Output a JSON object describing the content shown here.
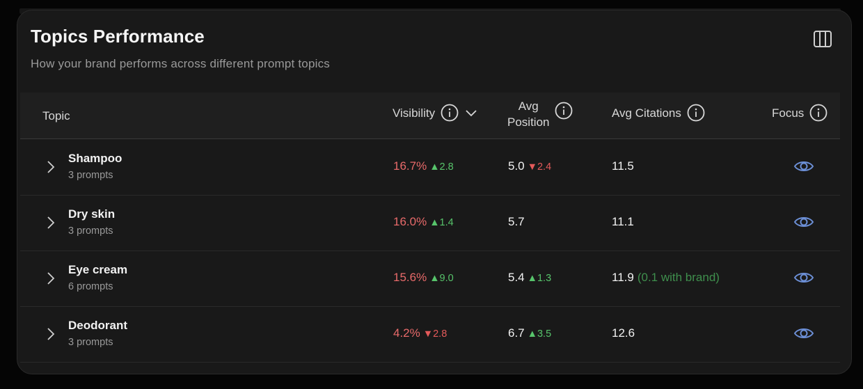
{
  "header": {
    "title": "Topics Performance",
    "subtitle": "How your brand performs across different prompt topics"
  },
  "columns": {
    "topic": "Topic",
    "visibility": "Visibility",
    "avg_position_line1": "Avg",
    "avg_position_line2": "Position",
    "avg_citations": "Avg Citations",
    "focus": "Focus"
  },
  "colors": {
    "negative": "#e86a6a",
    "positive": "#57c46b",
    "brand_note": "#3f8f4d",
    "focus_icon": "#6c8fd6"
  },
  "rows": [
    {
      "name": "Shampoo",
      "prompts": "3 prompts",
      "visibility": "16.7%",
      "visibility_delta": "▲2.8",
      "avg_position": "5.0",
      "avg_position_delta": "▼2.4",
      "avg_citations": "11.5",
      "citations_note": ""
    },
    {
      "name": "Dry skin",
      "prompts": "3 prompts",
      "visibility": "16.0%",
      "visibility_delta": "▲1.4",
      "avg_position": "5.7",
      "avg_position_delta": "",
      "avg_citations": "11.1",
      "citations_note": ""
    },
    {
      "name": "Eye cream",
      "prompts": "6 prompts",
      "visibility": "15.6%",
      "visibility_delta": "▲9.0",
      "avg_position": "5.4",
      "avg_position_delta": "▲1.3",
      "avg_citations": "11.9",
      "citations_note": "(0.1 with brand)"
    },
    {
      "name": "Deodorant",
      "prompts": "3 prompts",
      "visibility": "4.2%",
      "visibility_delta": "▼2.8",
      "avg_position": "6.7",
      "avg_position_delta": "▲3.5",
      "avg_citations": "12.6",
      "citations_note": ""
    }
  ]
}
